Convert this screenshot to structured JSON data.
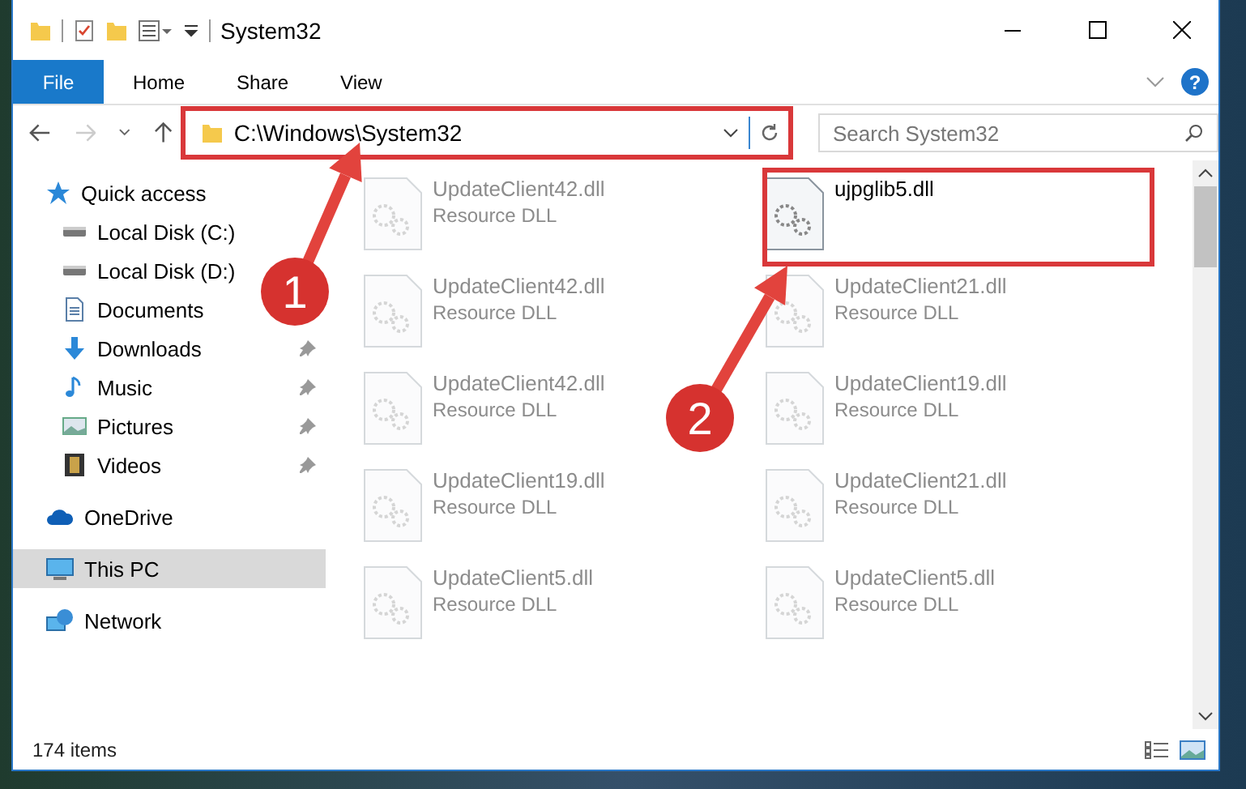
{
  "window": {
    "title": "System32"
  },
  "ribbon_tabs": [
    {
      "label": "File",
      "selected": true
    },
    {
      "label": "Home",
      "selected": false
    },
    {
      "label": "Share",
      "selected": false
    },
    {
      "label": "View",
      "selected": false
    }
  ],
  "help": {
    "label": "?"
  },
  "address": {
    "path": "C:\\Windows\\System32"
  },
  "search": {
    "placeholder": "Search System32"
  },
  "sidebar": {
    "items": [
      {
        "label": "Quick access",
        "kind": "quick",
        "pinned": false,
        "selected": false,
        "children": [
          {
            "label": "Local Disk (C:)",
            "kind": "disk",
            "pinned": false,
            "selected": false
          },
          {
            "label": "Local Disk (D:)",
            "kind": "disk",
            "pinned": false,
            "selected": false
          },
          {
            "label": "Documents",
            "kind": "docs",
            "pinned": false,
            "selected": false
          },
          {
            "label": "Downloads",
            "kind": "downloads",
            "pinned": true,
            "selected": false
          },
          {
            "label": "Music",
            "kind": "music",
            "pinned": true,
            "selected": false
          },
          {
            "label": "Pictures",
            "kind": "pictures",
            "pinned": true,
            "selected": false
          },
          {
            "label": "Videos",
            "kind": "videos",
            "pinned": true,
            "selected": false
          }
        ]
      },
      {
        "label": "OneDrive",
        "kind": "cloud",
        "pinned": false,
        "selected": false
      },
      {
        "label": "This PC",
        "kind": "pc",
        "pinned": false,
        "selected": true
      },
      {
        "label": "Network",
        "kind": "network",
        "pinned": false,
        "selected": false
      }
    ]
  },
  "files": [
    {
      "name": "UpdateClient42.dll",
      "type": "Resource DLL",
      "dimmed": true
    },
    {
      "name": "ujpglib5.dll",
      "dimmed": false
    },
    {
      "name": "UpdateClient42.dll",
      "type": "Resource DLL",
      "dimmed": true
    },
    {
      "name": "UpdateClient21.dll",
      "type": "Resource DLL",
      "dimmed": true
    },
    {
      "name": "UpdateClient42.dll",
      "type": "Resource DLL",
      "dimmed": true
    },
    {
      "name": "UpdateClient19.dll",
      "type": "Resource DLL",
      "dimmed": true
    },
    {
      "name": "UpdateClient19.dll",
      "type": "Resource DLL",
      "dimmed": true
    },
    {
      "name": "UpdateClient21.dll",
      "type": "Resource DLL",
      "dimmed": true
    },
    {
      "name": "UpdateClient5.dll",
      "type": "Resource DLL",
      "dimmed": true
    },
    {
      "name": "UpdateClient5.dll",
      "type": "Resource DLL",
      "dimmed": true
    }
  ],
  "status_bar": {
    "count": "174 items"
  },
  "annotations": [
    {
      "label": "1"
    },
    {
      "label": "2"
    }
  ]
}
